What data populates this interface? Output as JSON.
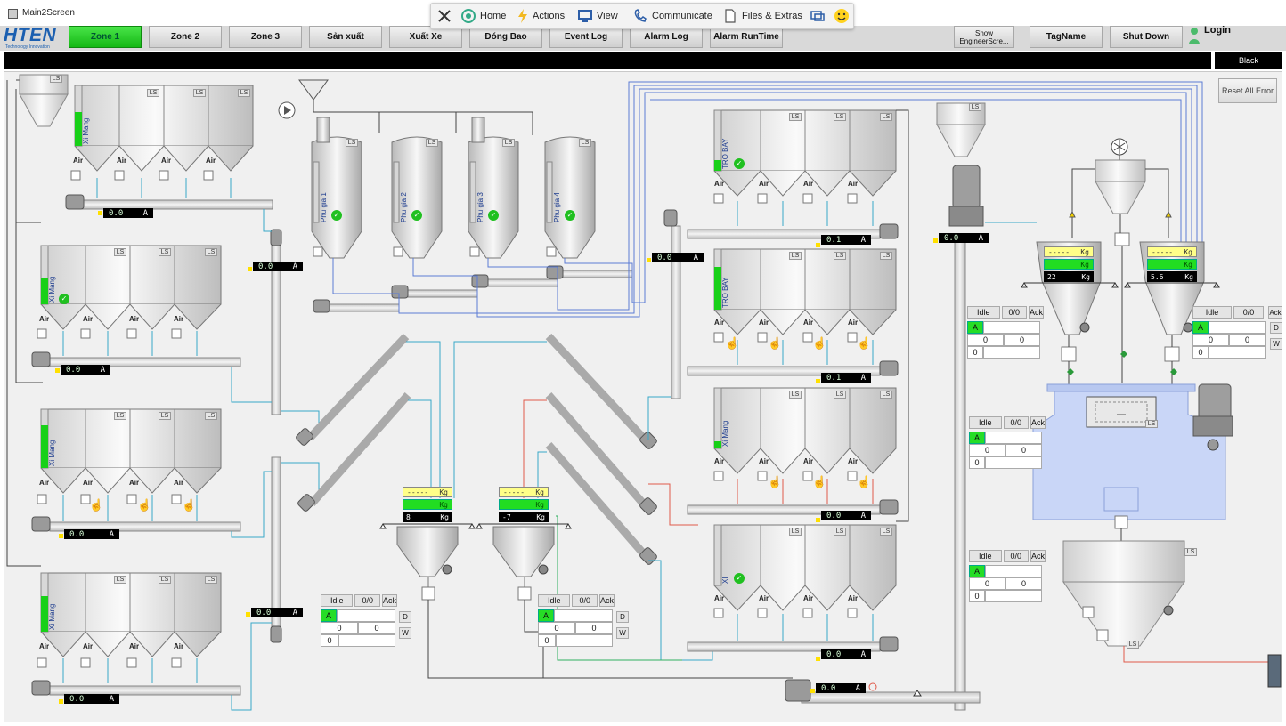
{
  "window": {
    "title": "Main2Screen"
  },
  "remote_toolbar": {
    "home": "Home",
    "actions": "Actions",
    "view": "View",
    "communicate": "Communicate",
    "files": "Files & Extras"
  },
  "logo": {
    "main": "HTEN",
    "sub": "Technology Innovation"
  },
  "nav": {
    "tabs": [
      "Zone 1",
      "Zone 2",
      "Zone 3",
      "Sản xuất",
      "Xuất Xe",
      "Đóng Bao",
      "Event Log",
      "Alarm Log",
      "Alarm RunTime"
    ],
    "active_tab": "Zone 1",
    "show_engineer": "Show EngineerScre...",
    "tagname": "TagName",
    "shutdown": "Shut Down",
    "login": "Login"
  },
  "status": {
    "black_label": "Black"
  },
  "reset_all_error": "Reset All Error",
  "common": {
    "ls": "LS",
    "air": "Air",
    "unit_a": "A",
    "unit_kg": "Kg",
    "idle": "Idle",
    "ratio": "0/0",
    "ack": "Ack",
    "a": "A",
    "d": "D",
    "w": "W",
    "zero": "0"
  },
  "cement_groups": [
    {
      "name": "Xi Mang",
      "current": "0.0"
    },
    {
      "name": "Xi Mang",
      "current": "0.0"
    },
    {
      "name": "Xi Mang",
      "current": "0.0"
    },
    {
      "name": "Xi Mang",
      "current": "0.0"
    }
  ],
  "elevators": {
    "left_upper": "0.0",
    "left_lower": "0.0",
    "center": "0.0",
    "right_top": "0.0",
    "bottom": "0.0"
  },
  "additive_silos": [
    {
      "name": "Phu gia 1"
    },
    {
      "name": "Phu gia 2"
    },
    {
      "name": "Phu gia 3"
    },
    {
      "name": "Phu gia 4"
    }
  ],
  "right_groups": [
    {
      "name": "TRO BAY",
      "current": "0.1"
    },
    {
      "name": "TRO BAY",
      "current": "0.1"
    },
    {
      "name": "Xi Mang",
      "current": "0.0"
    },
    {
      "name": "XI",
      "current": "0.0"
    }
  ],
  "scales": [
    {
      "r1": "-----",
      "r2": "",
      "r3": "8"
    },
    {
      "r1": "-----",
      "r2": "",
      "r3": "-7"
    },
    {
      "r1": "-----",
      "r2": "",
      "r3": "22"
    },
    {
      "r1": "-----",
      "r2": "",
      "r3": "5.6"
    }
  ],
  "colors": {
    "active_tab": "#22c822",
    "pipe_blue": "#5b7bd5",
    "pipe_cyan": "#37a8c8",
    "pipe_red": "#e05a4a",
    "mixer": "#c9d6f7"
  }
}
